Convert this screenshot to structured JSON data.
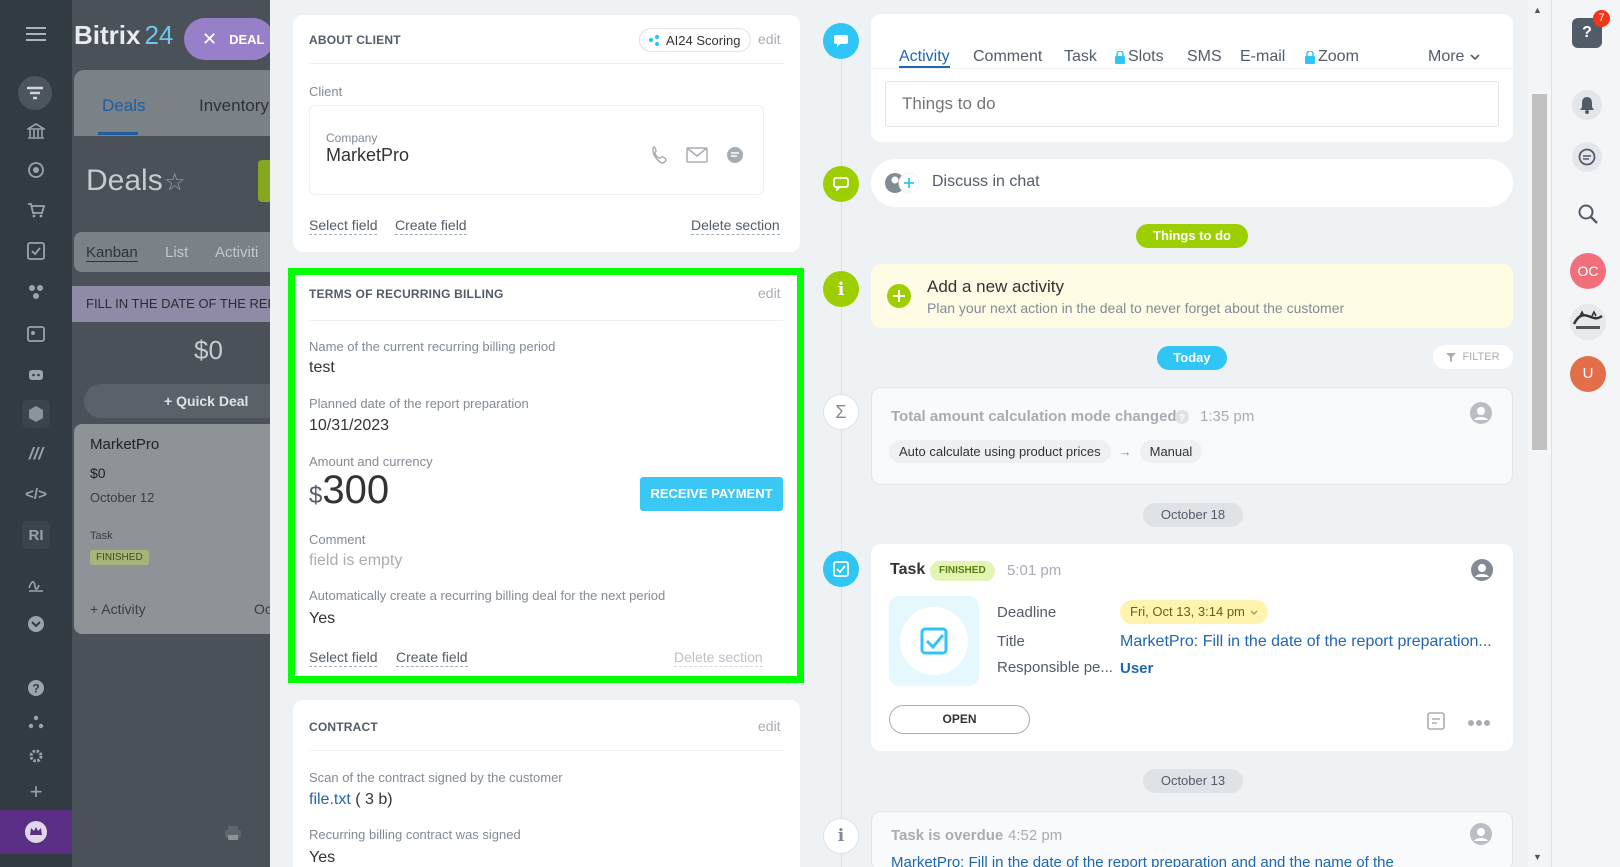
{
  "app": {
    "logo": "Bitrix",
    "logo_num": "24",
    "deal_badge": "DEAL"
  },
  "crm_tabs": [
    "Deals",
    "Inventory"
  ],
  "page": {
    "title": "Deals"
  },
  "views": [
    "Kanban",
    "List",
    "Activiti"
  ],
  "kanban": {
    "stage": "FILL IN THE DATE OF THE REP",
    "sum": "$0",
    "quick_deal": "+ Quick Deal",
    "card": {
      "title": "MarketPro",
      "amount": "$0",
      "date": "October 12",
      "task_lbl": "Task",
      "status": "FINISHED",
      "activity": "+ Activity",
      "cut": "Oc"
    }
  },
  "about": {
    "title": "ABOUT CLIENT",
    "scoring": "AI24 Scoring",
    "edit": "edit",
    "client_lbl": "Client",
    "company_lbl": "Company",
    "company": "MarketPro",
    "select_field": "Select field",
    "create_field": "Create field",
    "delete_section": "Delete section"
  },
  "billing": {
    "title": "TERMS OF RECURRING BILLING",
    "edit": "edit",
    "f1_lbl": "Name of the current recurring billing period",
    "f1": "test",
    "f2_lbl": "Planned date of the report preparation",
    "f2": "10/31/2023",
    "f3_lbl": "Amount and currency",
    "currency": "$",
    "amount": "300",
    "receive": "RECEIVE PAYMENT",
    "f4_lbl": "Comment",
    "f4": "field is empty",
    "f5_lbl": "Automatically create a recurring billing deal for the next period",
    "f5": "Yes",
    "select_field": "Select field",
    "create_field": "Create field",
    "delete_section": "Delete section"
  },
  "contract": {
    "title": "CONTRACT",
    "edit": "edit",
    "f1_lbl": "Scan of the contract signed by the customer",
    "file": "file.txt",
    "size": "( 3 b)",
    "f2_lbl": "Recurring billing contract was signed",
    "f2": "Yes"
  },
  "timeline": {
    "tabs": [
      "Activity",
      "Comment",
      "Task",
      "Slots",
      "SMS",
      "E-mail",
      "Zoom"
    ],
    "more": "More",
    "todo_ph": "Things to do",
    "discuss": "Discuss in chat",
    "pill_todo": "Things to do",
    "add_title": "Add a new activity",
    "add_sub": "Plan your next action in the deal to never forget about the customer",
    "today": "Today",
    "filter": "FILTER",
    "e1": {
      "title": "Total amount calculation mode changed",
      "time": "1:35 pm",
      "from": "Auto calculate using product prices",
      "arrow": "→",
      "to": "Manual"
    },
    "d1": "October 18",
    "e2": {
      "title": "Task",
      "status": "FINISHED",
      "time": "5:01 pm",
      "deadline_lbl": "Deadline",
      "deadline": "Fri, Oct 13, 3:14 pm",
      "title_lbl": "Title",
      "task_title": "MarketPro: Fill in the date of the report preparation...",
      "resp_lbl": "Responsible pe...",
      "resp": "User",
      "open": "OPEN"
    },
    "d2": "October 13",
    "e3": {
      "title": "Task is overdue",
      "time": "4:52 pm",
      "text": "MarketPro: Fill in the date of the report preparation and and the name of the"
    }
  },
  "right": {
    "badge": "7",
    "avatar_oc": "OC",
    "avatar_u": "U"
  },
  "colors": {
    "accent": "#2fc6f6",
    "green": "#9dcf00",
    "highlight": "#00ff00",
    "brand": "#2067b0"
  }
}
